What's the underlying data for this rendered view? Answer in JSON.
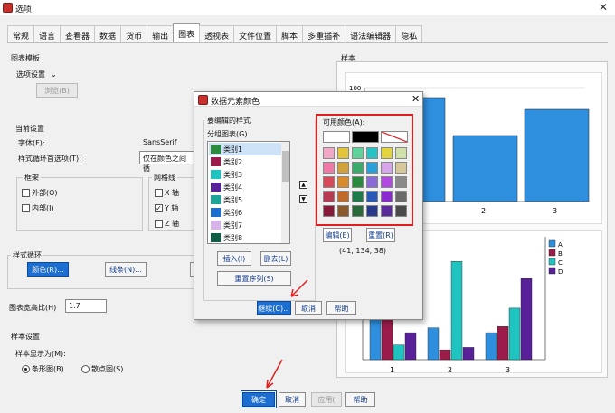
{
  "window": {
    "title": "选项",
    "close": "✕"
  },
  "tabs": [
    "常规",
    "语言",
    "查看器",
    "数据",
    "货币",
    "输出",
    "图表",
    "透视表",
    "文件位置",
    "脚本",
    "多重插补",
    "语法编辑器",
    "隐私"
  ],
  "template": {
    "heading": "图表模板",
    "select": "选项设置",
    "browse": "浏览(B)"
  },
  "current": {
    "heading": "当前设置",
    "font_label": "字体(F):",
    "font_value": "SansSerif",
    "cycle_label": "样式循环首选项(T):",
    "cycle_value": "仅在颜色之间循",
    "frame": {
      "heading": "框架",
      "outer": "外部(O)",
      "inner": "内部(I)"
    },
    "grid": {
      "heading": "网格线",
      "x": "X 轴",
      "y": "Y 轴",
      "z": "Z 轴"
    }
  },
  "style_cycle": {
    "heading": "样式循环",
    "colors": "颜色(R)...",
    "lines": "线条(N)..."
  },
  "aspect": {
    "label": "图表宽高比(H)",
    "value": "1.7"
  },
  "sample_settings": {
    "heading": "样本设置",
    "show_as": "样本显示为(M):",
    "bar": "条形图(B)",
    "scatter": "散点图(S)"
  },
  "sample": {
    "heading": "样本"
  },
  "bottom": {
    "ok": "确定",
    "cancel": "取消",
    "apply": "应用(",
    "help": "帮助"
  },
  "dialog": {
    "title": "数据元素颜色",
    "edit_styles": "要编辑的样式",
    "grouped": "分组图表(G)",
    "items": [
      "类别1",
      "类别2",
      "类别3",
      "类别4",
      "类别5",
      "类别6",
      "类别7",
      "类别8"
    ],
    "insert": "插入(I)",
    "delete": "删去(L)",
    "reorder": "重置序列(S)",
    "available": "可用颜色(A):",
    "edit": "编辑(E)",
    "reset": "重置(R)",
    "rgb": "(41, 134, 38)",
    "continue": "继续(C)...",
    "cancel": "取消",
    "help": "帮助"
  },
  "top_chart": {
    "type": "bar",
    "categories": [
      "1",
      "2",
      "3"
    ],
    "values": [
      null,
      null,
      null
    ],
    "ytick": "100",
    "xticks": [
      "2",
      "3"
    ],
    "color": "#2e8fde"
  },
  "chart_data": {
    "type": "bar",
    "categories": [
      "1",
      "2",
      "3"
    ],
    "series": [
      {
        "name": "A",
        "color": "#2e8fde"
      },
      {
        "name": "B",
        "color": "#9b1b4a"
      },
      {
        "name": "C",
        "color": "#1fc4c0"
      },
      {
        "name": "D",
        "color": "#58219a"
      }
    ]
  }
}
